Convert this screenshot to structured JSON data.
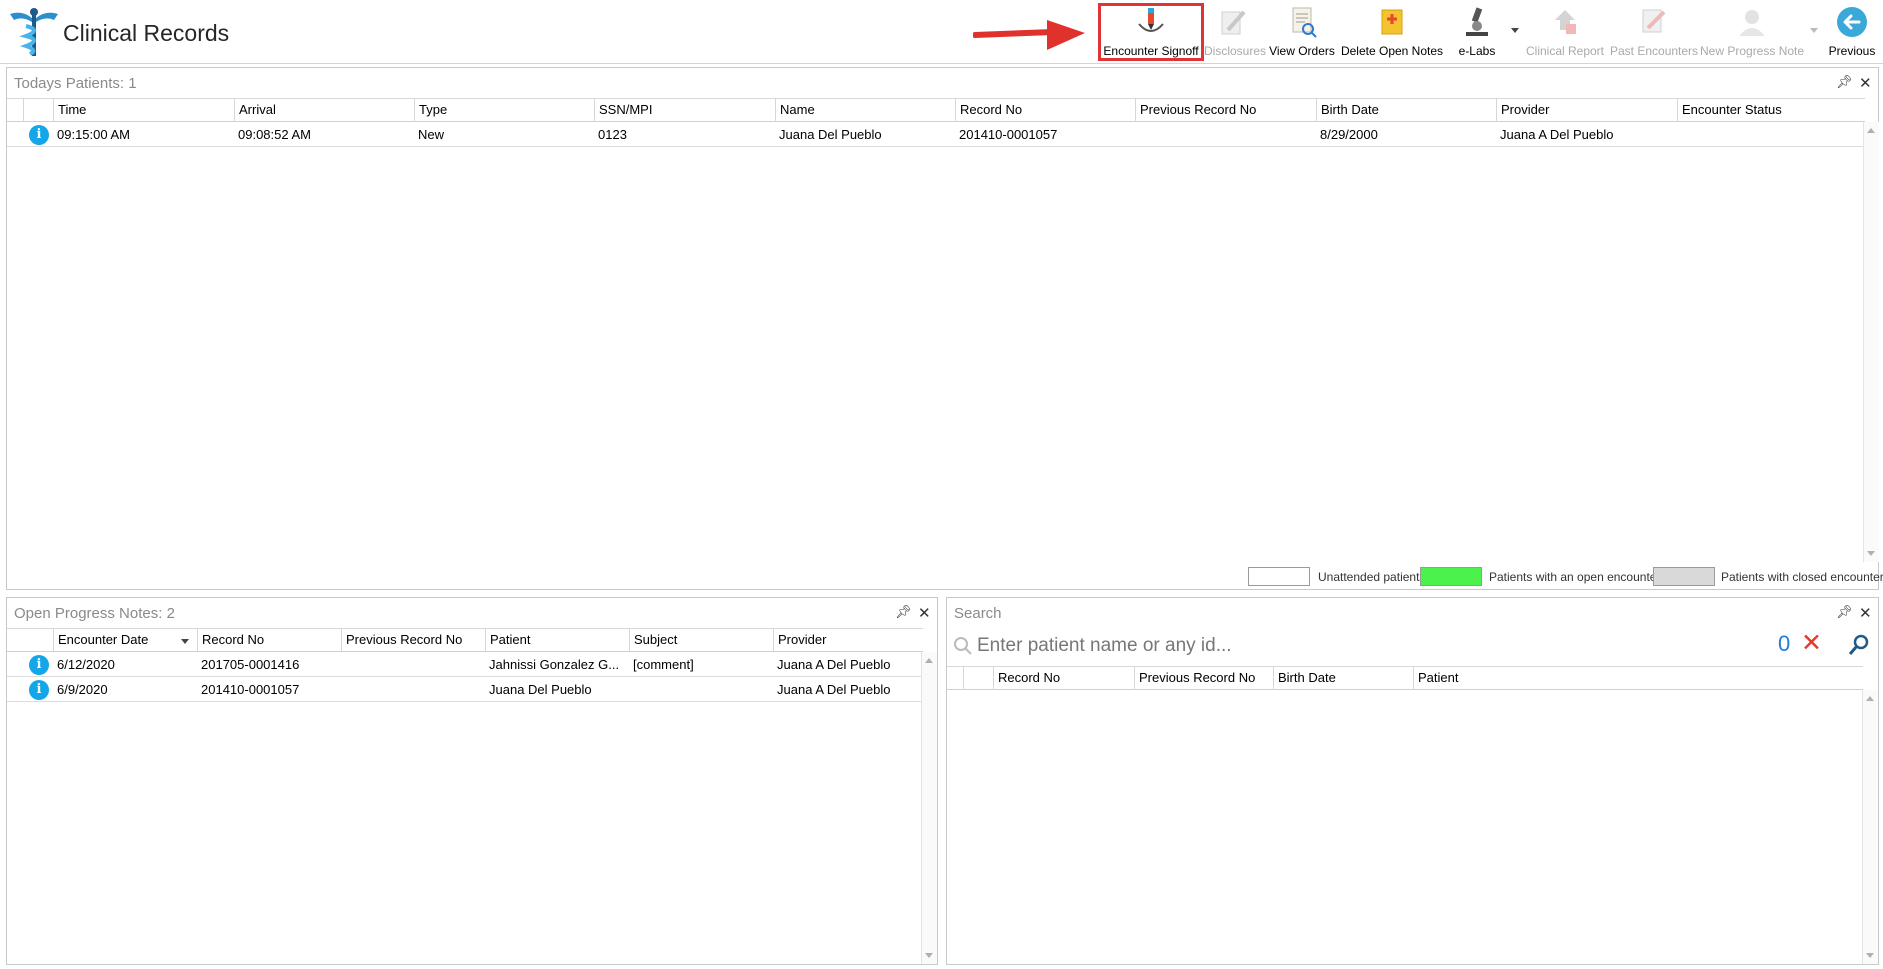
{
  "app": {
    "title": "Clinical Records"
  },
  "toolbar": {
    "encounter_signoff": "Encounter Signoff",
    "disclosures": "Disclosures",
    "view_orders": "View Orders",
    "delete_open_notes": "Delete Open Notes",
    "e_labs": "e-Labs",
    "clinical_report": "Clinical Report",
    "past_encounters": "Past Encounters",
    "new_progress_note": "New Progress Note",
    "previous": "Previous"
  },
  "todays_patients": {
    "title": "Todays Patients:",
    "count": "1",
    "columns": [
      "Time",
      "Arrival",
      "Type",
      "SSN/MPI",
      "Name",
      "Record No",
      "Previous Record No",
      "Birth Date",
      "Provider",
      "Encounter Status"
    ],
    "rows": [
      {
        "time": "09:15:00 AM",
        "arrival": "09:08:52 AM",
        "type": "New",
        "ssn": "0123",
        "name": "Juana Del Pueblo",
        "record_no": "201410-0001057",
        "prev_record_no": "",
        "birth_date": "8/29/2000",
        "provider": "Juana A Del Pueblo",
        "status": ""
      }
    ]
  },
  "legend": {
    "unattended": "Unattended patients",
    "open": "Patients with an open encounter",
    "closed": "Patients with closed encounters",
    "colors": {
      "unattended": "#ffffff",
      "open": "#4cf24c",
      "closed": "#d9d9d9"
    }
  },
  "open_notes": {
    "title": "Open Progress Notes:",
    "count": "2",
    "columns": [
      "Encounter Date",
      "Record No",
      "Previous Record No",
      "Patient",
      "Subject",
      "Provider"
    ],
    "rows": [
      {
        "date": "6/12/2020",
        "record_no": "201705-0001416",
        "prev_record_no": "",
        "patient": "Jahnissi Gonzalez G...",
        "subject": "[comment]",
        "provider": "Juana A Del Pueblo"
      },
      {
        "date": "6/9/2020",
        "record_no": "201410-0001057",
        "prev_record_no": "",
        "patient": "Juana Del Pueblo",
        "subject": "",
        "provider": "Juana A Del Pueblo"
      }
    ]
  },
  "search": {
    "title": "Search",
    "placeholder": "Enter patient name or any id...",
    "count": "0",
    "columns": [
      "Record No",
      "Previous Record No",
      "Birth Date",
      "Patient"
    ]
  },
  "colors": {
    "accent": "#13a6e8",
    "highlight": "#e03434",
    "arrow": "#e0322c"
  }
}
